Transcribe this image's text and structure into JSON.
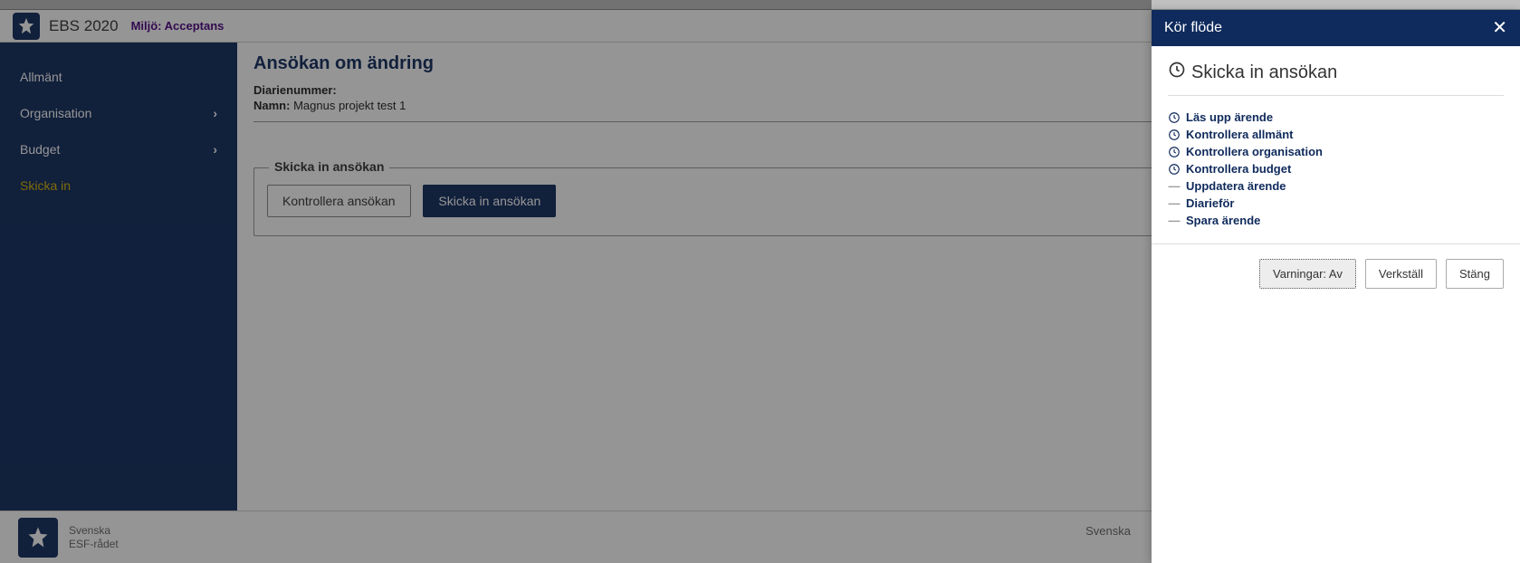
{
  "header": {
    "app_title": "EBS 2020",
    "env_label": "Miljö: Acceptans"
  },
  "sidebar": {
    "items": [
      {
        "label": "Allmänt",
        "has_children": false,
        "active": false
      },
      {
        "label": "Organisation",
        "has_children": true,
        "active": false
      },
      {
        "label": "Budget",
        "has_children": true,
        "active": false
      },
      {
        "label": "Skicka in",
        "has_children": false,
        "active": true
      }
    ]
  },
  "main": {
    "title": "Ansökan om ändring",
    "diarie_label": "Diarienummer:",
    "diarie_value": "",
    "name_label": "Namn:",
    "name_value": "Magnus projekt test 1",
    "fieldset_legend": "Skicka in ansökan",
    "btn_check": "Kontrollera ansökan",
    "btn_send": "Skicka in ansökan"
  },
  "footer": {
    "org_line1": "Svenska",
    "org_line2": "ESF-rådet",
    "lang": "Svenska"
  },
  "panel": {
    "header": "Kör flöde",
    "title": "Skicka in ansökan",
    "steps": [
      {
        "label": "Läs upp ärende",
        "state": "clock"
      },
      {
        "label": "Kontrollera allmänt",
        "state": "clock"
      },
      {
        "label": "Kontrollera organisation",
        "state": "clock"
      },
      {
        "label": "Kontrollera budget",
        "state": "clock"
      },
      {
        "label": "Uppdatera ärende",
        "state": "pending"
      },
      {
        "label": "Diarieför",
        "state": "pending"
      },
      {
        "label": "Spara ärende",
        "state": "pending"
      }
    ],
    "btn_warnings": "Varningar: Av",
    "btn_execute": "Verkställ",
    "btn_close": "Stäng"
  }
}
